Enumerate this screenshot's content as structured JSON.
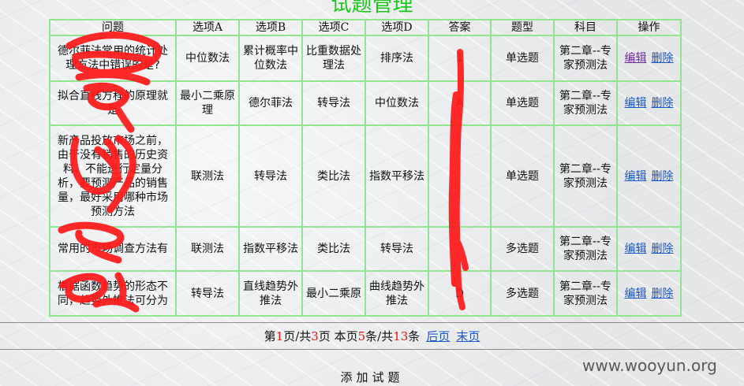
{
  "title": "试题管理",
  "table": {
    "headers": [
      "问题",
      "选项A",
      "选项B",
      "选项C",
      "选项D",
      "答案",
      "题型",
      "科目",
      "操作"
    ],
    "rows": [
      {
        "question": "德尔菲法常用的统计处理方法中错误的是?",
        "a": "中位数法",
        "b": "累计概率中位数法",
        "c": "比重数据处理法",
        "d": "排序法",
        "answer": "1",
        "type": "单选题",
        "subject": "第二章--专家预测法"
      },
      {
        "question": "拟合直线方程的原理就是",
        "a": "最小二乘原理",
        "b": "德尔菲法",
        "c": "转导法",
        "d": "中位数法",
        "answer": "A",
        "type": "单选题",
        "subject": "第二章--专家预测法"
      },
      {
        "question": "新产品投放市场之前，由于没有销售的历史资料，不能进行定量分析，要预测产品的销售量，最好采用哪种市场预测方法",
        "a": "联测法",
        "b": "转导法",
        "c": "类比法",
        "d": "指数平移法",
        "answer": "",
        "type": "单选题",
        "subject": "第二章--专家预测法"
      },
      {
        "question": "常用的市场调查方法有",
        "a": "联测法",
        "b": "指数平移法",
        "c": "类比法",
        "d": "转导法",
        "answer": "",
        "type": "多选题",
        "subject": "第二章--专家预测法"
      },
      {
        "question": "根据函数趋势的形态不同，趋势外推法可分为",
        "a": "转导法",
        "b": "直线趋势外推法",
        "c": "最小二乘原",
        "d": "曲线趋势外推法",
        "answer": "D",
        "type": "多选题",
        "subject": "第二章--专家预测法"
      }
    ],
    "edit_label": "编辑",
    "delete_label": "删除"
  },
  "pager": {
    "prefix": "第",
    "current_page": "1",
    "mid1": "页/共",
    "total_pages": "3",
    "mid2": "页 本页",
    "page_count": "5",
    "mid3": "条/共",
    "total_items": "13",
    "suffix": "条",
    "prev_label": "后页",
    "last_label": "末页"
  },
  "add_label": "添加试题",
  "watermark": "www.wooyun.org",
  "colors": {
    "title": "#19c819",
    "border": "#8fe68f",
    "link": "#1a56c8",
    "pager_number": "#e11111",
    "scribble": "#ff1a1a"
  }
}
